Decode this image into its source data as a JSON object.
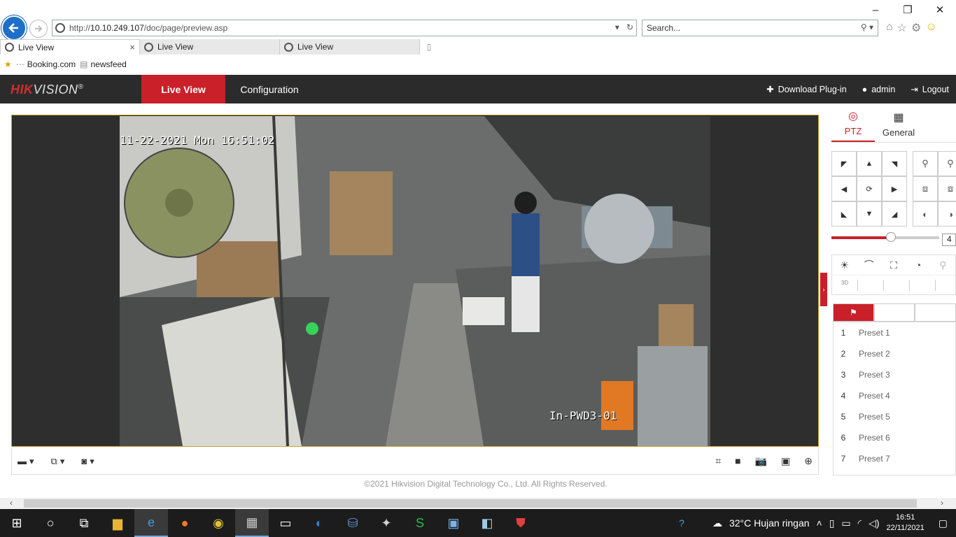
{
  "browser": {
    "url_prefix": "http://",
    "url_host": "10.10.249.107",
    "url_path": "/doc/page/preview.asp",
    "search_placeholder": "Search...",
    "tabs": [
      {
        "label": "Live View"
      },
      {
        "label": "Live View"
      },
      {
        "label": "Live View"
      }
    ],
    "favorites": [
      {
        "label": "Booking.com"
      },
      {
        "label": "newsfeed"
      }
    ]
  },
  "app": {
    "logo_brand": "HIK",
    "logo_rest": "VISION",
    "logo_mark": "®",
    "nav": {
      "live_view": "Live View",
      "configuration": "Configuration"
    },
    "header_actions": {
      "download_plugin": "Download Plug-in",
      "user": "admin",
      "logout": "Logout"
    }
  },
  "video": {
    "osd_time": "11-22-2021 Mon 16:51:02",
    "osd_name": "In-PWD3-01"
  },
  "panel": {
    "tabs": {
      "ptz": "PTZ",
      "general": "General"
    },
    "speed_value": "4",
    "speed_level": 0.55,
    "presets": [
      {
        "num": "1",
        "name": "Preset 1"
      },
      {
        "num": "2",
        "name": "Preset 2"
      },
      {
        "num": "3",
        "name": "Preset 3"
      },
      {
        "num": "4",
        "name": "Preset 4"
      },
      {
        "num": "5",
        "name": "Preset 5"
      },
      {
        "num": "6",
        "name": "Preset 6"
      },
      {
        "num": "7",
        "name": "Preset 7"
      }
    ]
  },
  "footer": {
    "copyright": "©2021 Hikvision Digital Technology Co., Ltd. All Rights Reserved."
  },
  "taskbar": {
    "weather": "32°C  Hujan ringan",
    "time": "16:51",
    "date": "22/11/2021"
  },
  "colors": {
    "accent": "#c9202a",
    "nav_bg": "#2b2b2b",
    "video_border": "#c9a227"
  }
}
